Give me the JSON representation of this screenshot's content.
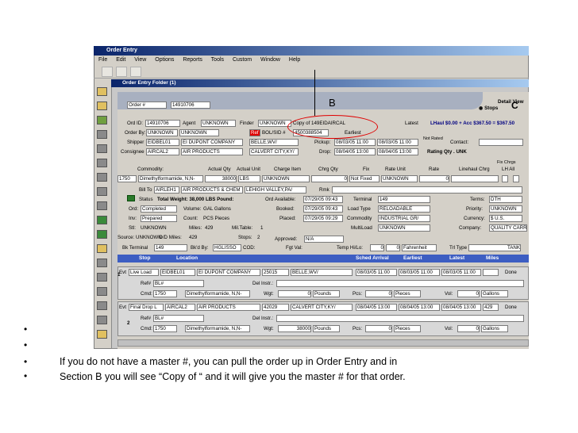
{
  "window": {
    "title": "Order Entry"
  },
  "menu": [
    "File",
    "Edit",
    "View",
    "Options",
    "Reports",
    "Tools",
    "Custom",
    "Window",
    "Help"
  ],
  "folder": {
    "title": "Order Entry Folder (1)"
  },
  "header": {
    "order_select": "Order #",
    "order_number": "14910706",
    "detail_view_label": "Detail View",
    "stops_label": "Stops",
    "c_label": "C",
    "b_marker": "B"
  },
  "order": {
    "ord_id_label": "Ord ID:",
    "ord_id": "14910706",
    "agent_label": "Agent",
    "agent": "UNKNOWN",
    "finder_label": "Finder",
    "finder": "UNKNOWN",
    "copy_of": "Copy of 149EIDAIRCAL",
    "latest_label": "Latest",
    "lhaul": "LHaul $0.00 + Acc $367.50 = $367.50",
    "order_by_label": "Order By:",
    "order_by_1": "UNKNOWN",
    "order_by_2": "UNKNOWN",
    "ref_label": "Ref",
    "bol_label": "BOL/SID #",
    "bol_value": "4500388504",
    "earliest_label": "Earliest",
    "shipper_label": "Shipper",
    "shipper_code": "EIDBEL01",
    "shipper_name": "EI DUPONT COMPANY",
    "shipper_city": "BELLE,WV/",
    "pickup_label": "Pickup:",
    "pickup_1": "08/03/05 11:00",
    "pickup_2": "08/03/05 11:00",
    "not_rated": "Not Rated",
    "contact_label": "Contact:",
    "consignee_label": "Consignee",
    "consignee_code": "AIRCAL2",
    "consignee_name": "AIR PRODUCTS",
    "consignee_city": "CALVERT CITY,KY/",
    "drop_label": "Drop:",
    "drop_1": "08/04/05 13:00",
    "drop_2": "08/04/05 13:00",
    "rating_label": "Rating Qty . UNK",
    "fix_chrg": "Fix Chrgs",
    "lh_all": "LH All"
  },
  "commodity": {
    "headers": [
      "Commodity:",
      "Actual Qty",
      "Actual Unit",
      "Charge Item",
      "Chrg Qty",
      "Fix",
      "Rate Unit",
      "Rate",
      "Linehaul Chrg"
    ],
    "code": "1750",
    "name": "Dimethylformamide, N,N-",
    "qty": "38000",
    "unit": "LBS",
    "charge_item": "UNKNOWN",
    "chrg_qty": "0",
    "fix": "Not Fixed",
    "rate_unit": "UNKNOWN",
    "rate": "0"
  },
  "billto": {
    "label": "Bill To",
    "code": "AIRLEH1",
    "name": "AIR PRODUCTS & CHEM",
    "city": "LEHIGH VALLEY,PA/",
    "rmk_label": "Rmk",
    "status_label": "Status",
    "total_weight": "Total Weight: 38,000 LBS Pound:",
    "ord_avail_label": "Ord Available:",
    "ord_avail": "07/29/05 09:43",
    "terminal_label": "Terminal",
    "terminal": "149",
    "terms_label": "Terms:",
    "terms": "DTH",
    "ord_label": "Ord:",
    "ord": "Completed",
    "volume_label": "Volume:",
    "volume": "GAL Gallons",
    "booked_label": "Booked:",
    "booked": "07/29/05 09:43",
    "load_type_label": "Load Type",
    "load_type": "RELOADABLE",
    "priority_label": "Priority:",
    "priority": "UNKNOWN",
    "inv_label": "Inv:",
    "inv": "Prepared",
    "count_label": "Count:",
    "count": "PCS Pieces",
    "placed_label": "Placed:",
    "placed": "07/29/05 09:29",
    "commodity_label": "Commodity",
    "commodity": "INDUSTRIAL GR/",
    "currency_label": "Currency:",
    "currency": "$ U.S.",
    "stl_label": "Stl:",
    "stl": "UNKNOWN",
    "miles_label": "Miles:",
    "miles": "429",
    "mil_table_label": "Mil.Table:",
    "mil_table": "1",
    "multiload_label": "MultiLoad",
    "multiload": "UNKNOWN",
    "company_label": "Company:",
    "company": "QUALITY CARRIE",
    "source_label": "Source: UNKNOWN",
    "od_miles_label": "O/D Miles:",
    "od_miles": "429",
    "stops_label": "Stops:",
    "stops": "2",
    "approved_label": "Approved:",
    "approved": "N/A",
    "bk_terminal_label": "Bk Terminal",
    "bk_terminal": "149",
    "bkd_by_label": "Bk'd By:",
    "bkd_by": "HGLISSO",
    "cod_label": "COD:",
    "fgt_val_label": "Fgt Val:",
    "temp_label": "Temp Hi/Lo:",
    "temp_1": "0",
    "temp_2": "0",
    "temp_unit": "Fahrenheit",
    "trl_type_label": "Trl Type",
    "trl_type": "TANK"
  },
  "stops_header": [
    "Stop",
    "Location",
    "Sched Arrival",
    "Earliest",
    "Latest",
    "Miles"
  ],
  "stops": [
    {
      "num": "1",
      "evt_label": "Evt",
      "evt": "Live Load",
      "code": "EIDBEL01",
      "name": "EI DUPONT COMPANY",
      "zip": "25015",
      "city": "BELLE,WV/",
      "sched": "08/03/05 11:00",
      "earliest": "08/03/05 11:00",
      "latest": "08/03/05 11:00",
      "miles": "",
      "status": "Done",
      "ref_label": "Ref#",
      "ref": "BL#",
      "del_instr_label": "Del Instr.:",
      "cmd_label": "Cmd:",
      "cmd": "1750",
      "cmd_name": "Dimethylformamide, N,N-",
      "wgt_label": "Wgt:",
      "wgt": "0",
      "wgt_unit": "Pounds",
      "pcs_label": "Pcs:",
      "pcs": "0",
      "pcs_unit": "Pieces",
      "vol_label": "Vol:",
      "vol": "0",
      "vol_unit": "Gallons"
    },
    {
      "num": "2",
      "evt_label": "Evt",
      "evt": "Final Drop L",
      "code": "AIRCAL2",
      "name": "AIR PRODUCTS",
      "zip": "42029",
      "city": "CALVERT CITY,KY/",
      "sched": "08/04/05 13:00",
      "earliest": "08/04/05 13:00",
      "latest": "08/04/05 13:00",
      "miles": "429",
      "status": "Done",
      "ref_label": "Ref#",
      "ref": "BL#",
      "del_instr_label": "Del Instr.:",
      "cmd_label": "Cmd:",
      "cmd": "1750",
      "cmd_name": "Dimethylformamide, N,N-",
      "wgt_label": "Wgt:",
      "wgt": "38000",
      "wgt_unit": "Pounds",
      "pcs_label": "Pcs:",
      "pcs": "0",
      "pcs_unit": "Pieces",
      "vol_label": "Vol:",
      "vol": "0",
      "vol_unit": "Gallons"
    }
  ],
  "caption": {
    "line1": "If you do not have a master #, you can pull the order up in Order Entry and in",
    "line2": "Section B you will see “Copy of “ and it will give you the master # for that order."
  },
  "colors": {
    "highlight_oval": "#e00000",
    "title_bar": "#0a246a",
    "stop_header": "#3d5ec2"
  }
}
